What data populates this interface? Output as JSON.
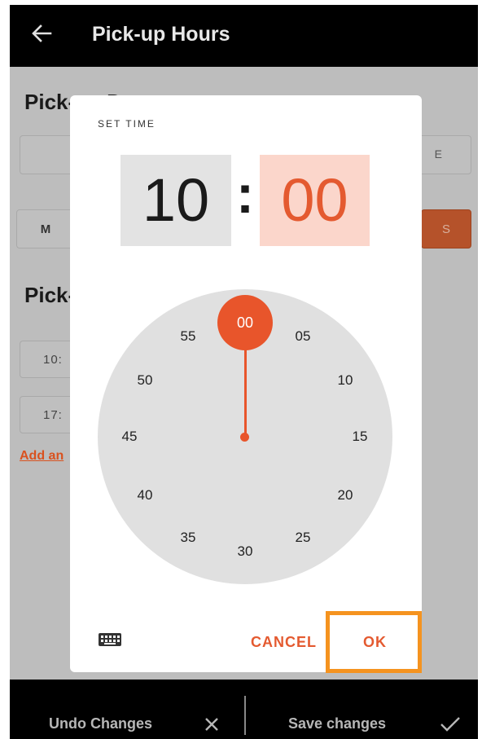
{
  "appbar": {
    "title": "Pick-up Hours",
    "back_icon": "arrow-left-icon"
  },
  "background": {
    "section1_title": "Pick-up D",
    "gray_bar_suffix": "E",
    "day_m": "M",
    "day_s": "S",
    "section2_title": "Pick-",
    "time1": "10:",
    "time2": "17:",
    "add_link": "Add an"
  },
  "dialog": {
    "label": "SET TIME",
    "hour": "10",
    "separator": ":",
    "minute": "00",
    "selected_minute": "00",
    "dial_numbers": [
      "55",
      "05",
      "50",
      "10",
      "45",
      "15",
      "40",
      "20",
      "35",
      "25",
      "30"
    ],
    "keyboard_icon": "keyboard-icon",
    "cancel_label": "CANCEL",
    "ok_label": "OK"
  },
  "bottom_bar": {
    "undo_label": "Undo Changes",
    "undo_icon": "close-icon",
    "save_label": "Save changes",
    "save_icon": "check-icon"
  },
  "colors": {
    "accent": "#e8552b",
    "minute_box_bg": "#fbd6cb",
    "hour_box_bg": "#e3e3e3",
    "highlight": "#f5931f"
  }
}
